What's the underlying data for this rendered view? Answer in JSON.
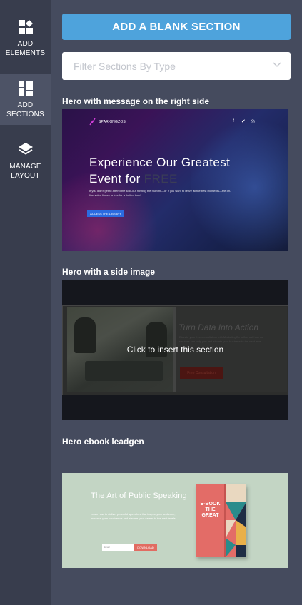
{
  "sidebar": {
    "items": [
      {
        "label_line1": "ADD",
        "label_line2": "ELEMENTS"
      },
      {
        "label_line1": "ADD",
        "label_line2": "SECTIONS"
      },
      {
        "label_line1": "MANAGE",
        "label_line2": "LAYOUT"
      }
    ],
    "active_index": 1
  },
  "panel": {
    "add_blank_label": "ADD A BLANK SECTION",
    "filter_placeholder": "Filter Sections By Type"
  },
  "sections": [
    {
      "title": "Hero with message on the right side",
      "preview": {
        "logo": "SPARKINGZOS",
        "headline_line1": "Experience Our Greatest",
        "headline_line2_prefix": "Event for",
        "headline_line2_highlight": "FREE",
        "body": "If you didn't get to attend the sold-out hosting the Summit—or if you want to relive all the best moments—the on-line video library is free for a limited time!",
        "cta": "ACCESS THE LIBRARY"
      }
    },
    {
      "title": "Hero with a side image",
      "hover_text": "Click to insert this section",
      "preview": {
        "heading": "Turn Data Into Action",
        "body": "Elevate your free consultation with MarketingCo to find out how our services can help you and elevate your business to the next level.",
        "cta": "Free Consultation"
      }
    },
    {
      "title": "Hero ebook leadgen",
      "preview": {
        "heading": "The Art of Public Speaking",
        "body": "Learn how to deliver powerful speeches that inspire your audience, increase your confidence and elevate your career to the next levels.",
        "email_placeholder": "Email",
        "cta": "DOWNLOAD",
        "book_text_line1": "E-BOOK",
        "book_text_line2": "THE",
        "book_text_line3": "GREAT"
      }
    }
  ],
  "colors": {
    "accent": "#4ea3dc",
    "rail_bg": "#383d4d",
    "panel_bg": "#454b5e",
    "rail_active": "#4d5366"
  }
}
